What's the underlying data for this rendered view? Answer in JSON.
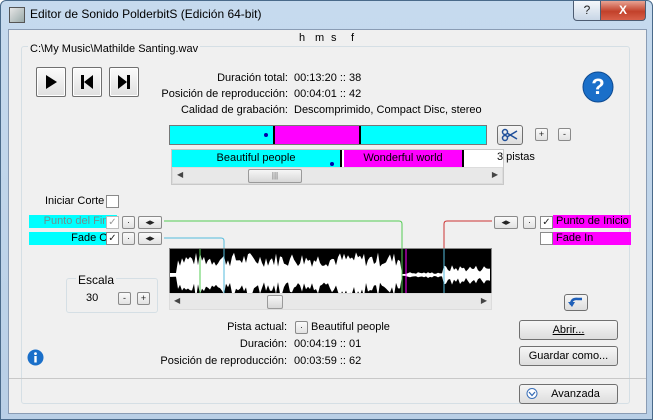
{
  "window": {
    "title": "Editor de Sonido PolderbitS (Edición 64-bit)",
    "help_glyph": "?",
    "close_glyph": "X"
  },
  "file": {
    "path": "C:\\My Music\\Mathilde Santing.wav"
  },
  "time_header": {
    "h": "h",
    "m": "m",
    "s": "s",
    "f": "f"
  },
  "info": [
    {
      "label": "Duración total:",
      "value": "00:13:20 :: 38"
    },
    {
      "label": "Posición de reproducción:",
      "value": "00:04:01 :: 42"
    },
    {
      "label": "Calidad de grabación:",
      "value": "Descomprimido, Compact Disc, stereo"
    }
  ],
  "tracks": {
    "items": [
      "Beautiful people",
      "Wonderful world"
    ],
    "count_label": "3 pistas",
    "plus": "+",
    "minus": "-"
  },
  "cut": {
    "start_cut_label": "Iniciar Corte",
    "end_point_label": "Punto del Final",
    "fade_out_label": "Fade Out",
    "start_point_label": "Punto de Inicio",
    "fade_in_label": "Fade In"
  },
  "scale": {
    "label": "Escala",
    "value": "30",
    "minus": "-",
    "plus": "+"
  },
  "current": {
    "track_label": "Pista actual:",
    "track_value": "Beautiful people",
    "duration_label": "Duración:",
    "duration_value": "00:04:19 :: 01",
    "position_label": "Posición de reproducción:",
    "position_value": "00:03:59 :: 62"
  },
  "buttons": {
    "open": "Abrir...",
    "save_as": "Guardar como...",
    "advanced": "Avanzada"
  },
  "icons": {
    "play": "play-icon",
    "prev": "skip-back-icon",
    "next": "skip-forward-icon",
    "help": "help-icon",
    "scissors": "scissors-icon",
    "undo": "undo-icon",
    "info": "info-icon"
  },
  "colors": {
    "cyan": "#00ffff",
    "magenta": "#ff00ff",
    "green_marker": "#55cc55",
    "red_marker": "#cc3333",
    "help_blue": "#1a6fc9"
  }
}
